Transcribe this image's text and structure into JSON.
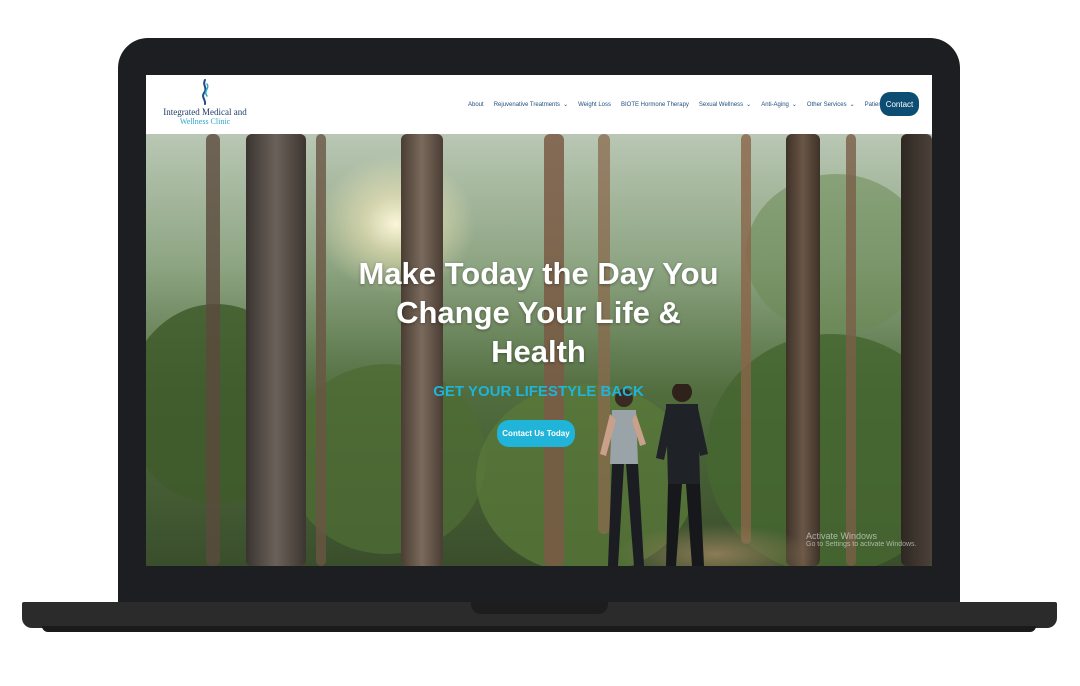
{
  "site": {
    "logo": {
      "line1": "Integrated Medical and",
      "line2": "Wellness Clinic"
    },
    "nav": [
      {
        "label": "About",
        "has_dropdown": false
      },
      {
        "label": "Rejuvenative Treatments",
        "has_dropdown": true
      },
      {
        "label": "Weight Loss",
        "has_dropdown": false
      },
      {
        "label": "BIOTE Hormone Therapy",
        "has_dropdown": false
      },
      {
        "label": "Sexual Wellness",
        "has_dropdown": true
      },
      {
        "label": "Anti-Aging",
        "has_dropdown": true
      },
      {
        "label": "Other Services",
        "has_dropdown": true
      },
      {
        "label": "Patients",
        "has_dropdown": true
      }
    ],
    "contact_button": "Contact"
  },
  "hero": {
    "title": "Make Today the Day You Change Your Life & Health",
    "subtitle": "GET YOUR LIFESTYLE BACK",
    "cta": "Contact Us Today"
  },
  "watermark": {
    "line1": "Activate Windows",
    "line2": "Go to Settings to activate Windows."
  },
  "colors": {
    "nav_text": "#1e4f80",
    "contact_button_bg": "#0e4d73",
    "accent": "#1fb4d8",
    "laptop_frame": "#1c1e21"
  }
}
